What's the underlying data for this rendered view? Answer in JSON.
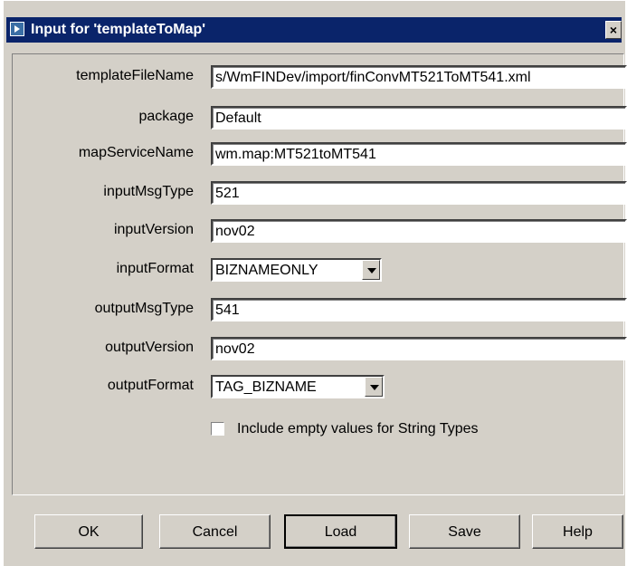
{
  "dialog": {
    "title": "Input for 'templateToMap'",
    "close_label": "×"
  },
  "fields": [
    {
      "label": "templateFileName",
      "value": "s/WmFINDev/import/finConvMT521ToMT541.xml"
    },
    {
      "label": "package",
      "value": "Default"
    },
    {
      "label": "mapServiceName",
      "value": "wm.map:MT521toMT541"
    },
    {
      "label": "inputMsgType",
      "value": "521"
    },
    {
      "label": "inputVersion",
      "value": "nov02"
    },
    {
      "label": "inputFormat",
      "value": "BIZNAMEONLY"
    },
    {
      "label": "outputMsgType",
      "value": "541"
    },
    {
      "label": "outputVersion",
      "value": "nov02"
    },
    {
      "label": "outputFormat",
      "value": "TAG_BIZNAME"
    }
  ],
  "checkbox": {
    "label": "Include empty values for String Types",
    "checked": false
  },
  "buttons": {
    "ok": "OK",
    "cancel": "Cancel",
    "load": "Load",
    "save": "Save",
    "help": "Help"
  },
  "colors": {
    "titlebar": "#0a246a",
    "face": "#d4d0c8"
  },
  "icons": {
    "title": "arrow-right-icon",
    "dropdown": "chevron-down-icon",
    "close": "close-icon"
  }
}
